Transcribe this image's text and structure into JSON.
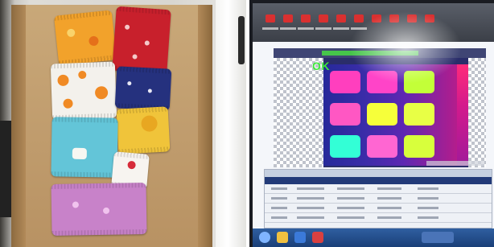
{
  "left_photo": {
    "packages": [
      {
        "color": "#f2a22b",
        "pattern": "orange"
      },
      {
        "color": "#c8202c",
        "pattern": "red"
      },
      {
        "color": "#f3f1ec",
        "pattern": "white-orange-dots"
      },
      {
        "color": "#25317e",
        "pattern": "navy"
      },
      {
        "color": "#f0c43a",
        "pattern": "yellow"
      },
      {
        "color": "#63c5d8",
        "pattern": "teal"
      },
      {
        "color": "#f7f4f0",
        "pattern": "white-red"
      },
      {
        "color": "#c882c9",
        "pattern": "purple"
      }
    ]
  },
  "right_photo": {
    "status_text": "OK",
    "colors": {
      "ok": "#3ee83b",
      "toolbar_icon": "#d93030",
      "viewer_bg": "#2a2d6a"
    }
  }
}
